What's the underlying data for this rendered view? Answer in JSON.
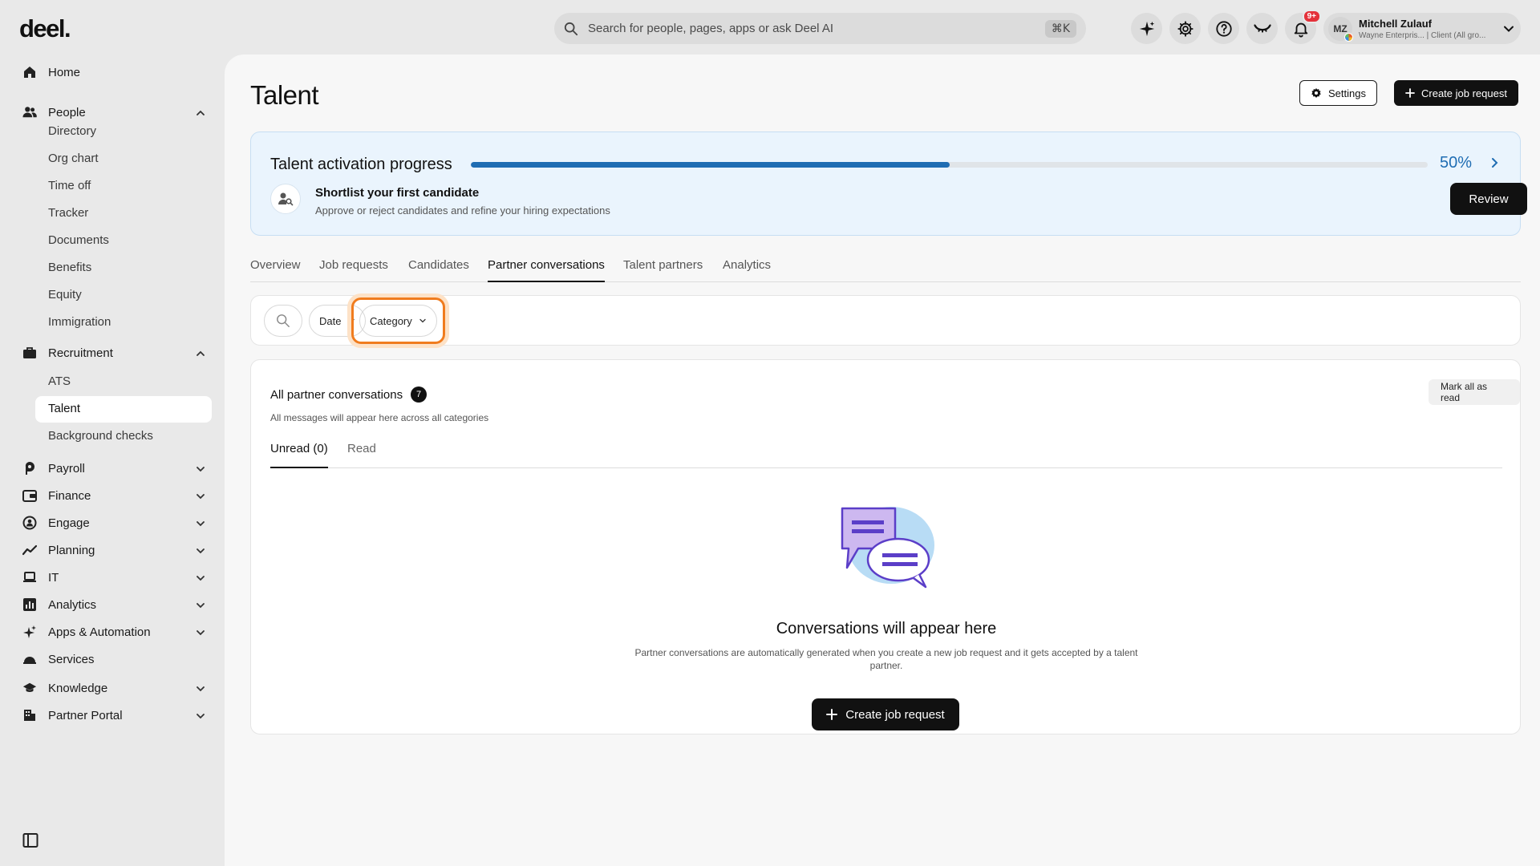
{
  "brand": {
    "logo": "deel."
  },
  "header": {
    "search_placeholder": "Search for people, pages, apps or ask Deel AI",
    "search_shortcut": "⌘K",
    "notification_badge": "9+",
    "user": {
      "initials": "MZ",
      "name": "Mitchell Zulauf",
      "subtitle": "Wayne Enterpris... | Client (All gro..."
    }
  },
  "sidebar": {
    "home": "Home",
    "people": {
      "label": "People",
      "items": [
        "Directory",
        "Org chart",
        "Time off",
        "Tracker",
        "Documents",
        "Benefits",
        "Equity",
        "Immigration"
      ]
    },
    "recruitment": {
      "label": "Recruitment",
      "items": [
        "ATS",
        "Talent",
        "Background checks"
      ],
      "active": "Talent"
    },
    "payroll": "Payroll",
    "finance": "Finance",
    "engage": "Engage",
    "planning": "Planning",
    "it": "IT",
    "analytics": "Analytics",
    "apps": "Apps & Automation",
    "services": "Services",
    "knowledge": "Knowledge",
    "partner_portal": "Partner Portal"
  },
  "page": {
    "title": "Talent",
    "settings_label": "Settings",
    "create_label": "Create job request"
  },
  "progress": {
    "title": "Talent activation progress",
    "percent_text": "50%",
    "percent_value": 0.5,
    "task_title": "Shortlist your first candidate",
    "task_subtitle": "Approve or reject candidates and refine your hiring expectations",
    "review_label": "Review"
  },
  "tabs": [
    "Overview",
    "Job requests",
    "Candidates",
    "Partner conversations",
    "Talent partners",
    "Analytics"
  ],
  "active_tab": "Partner conversations",
  "filters": {
    "date": "Date",
    "category": "Category"
  },
  "conversations": {
    "title": "All partner conversations",
    "count": "7",
    "subtitle": "All messages will appear here across all categories",
    "mark_all_label": "Mark all as read",
    "tabs": [
      "Unread (0)",
      "Read"
    ],
    "empty_title": "Conversations will appear here",
    "empty_text": "Partner conversations are automatically generated when you create a new job request and it gets accepted by a talent partner.",
    "cta_label": "Create job request"
  },
  "colors": {
    "accent": "#1f6db3",
    "highlight": "#f07c1e",
    "illustration_purple": "#5b3ec8"
  }
}
